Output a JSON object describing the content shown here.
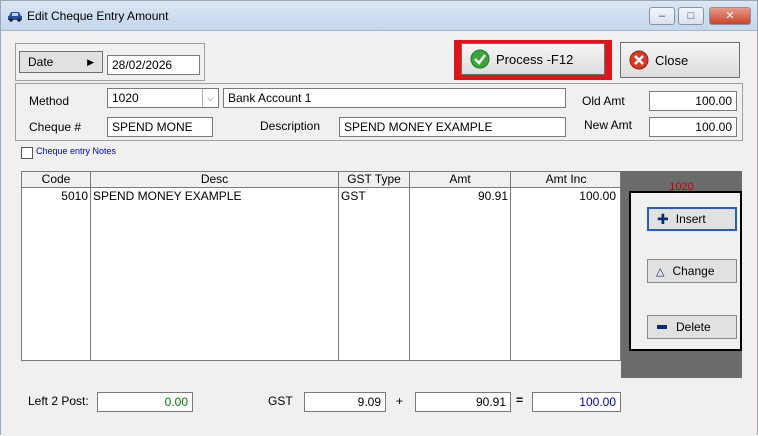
{
  "window": {
    "title": "Edit Cheque Entry Amount"
  },
  "top": {
    "date_button": "Date",
    "date_value": "28/02/2026",
    "process_button": "Process -F12",
    "close_button": "Close"
  },
  "form": {
    "method_label": "Method",
    "method_value": "1020",
    "bank_account_value": "Bank Account 1",
    "cheque_label": "Cheque #",
    "cheque_value": "SPEND MONE",
    "description_label": "Description",
    "description_value": "SPEND MONEY EXAMPLE",
    "old_amt_label": "Old Amt",
    "old_amt_value": "100.00",
    "new_amt_label": "New Amt",
    "new_amt_value": "100.00",
    "notes_checkbox_label": "Cheque entry Notes"
  },
  "grid": {
    "headers": [
      "Code",
      "Desc",
      "GST Type",
      "Amt",
      "Amt Inc"
    ],
    "rows": [
      {
        "code": "5010",
        "desc": "SPEND MONEY EXAMPLE",
        "gst_type": "GST",
        "amt": "90.91",
        "amt_inc": "100.00"
      }
    ]
  },
  "side": {
    "code_label": "1020",
    "insert": "Insert",
    "change": "Change",
    "delete": "Delete"
  },
  "totals": {
    "left2post_label": "Left 2 Post:",
    "left2post_value": "0.00",
    "gst_label": "GST",
    "gst_value": "9.09",
    "plus": "+",
    "net_value": "90.91",
    "equals": "=",
    "total_value": "100.00"
  },
  "colors": {
    "highlight": "#e3131b",
    "green": "#008000",
    "blue": "#0000cc",
    "accent_red": "#c00000"
  }
}
